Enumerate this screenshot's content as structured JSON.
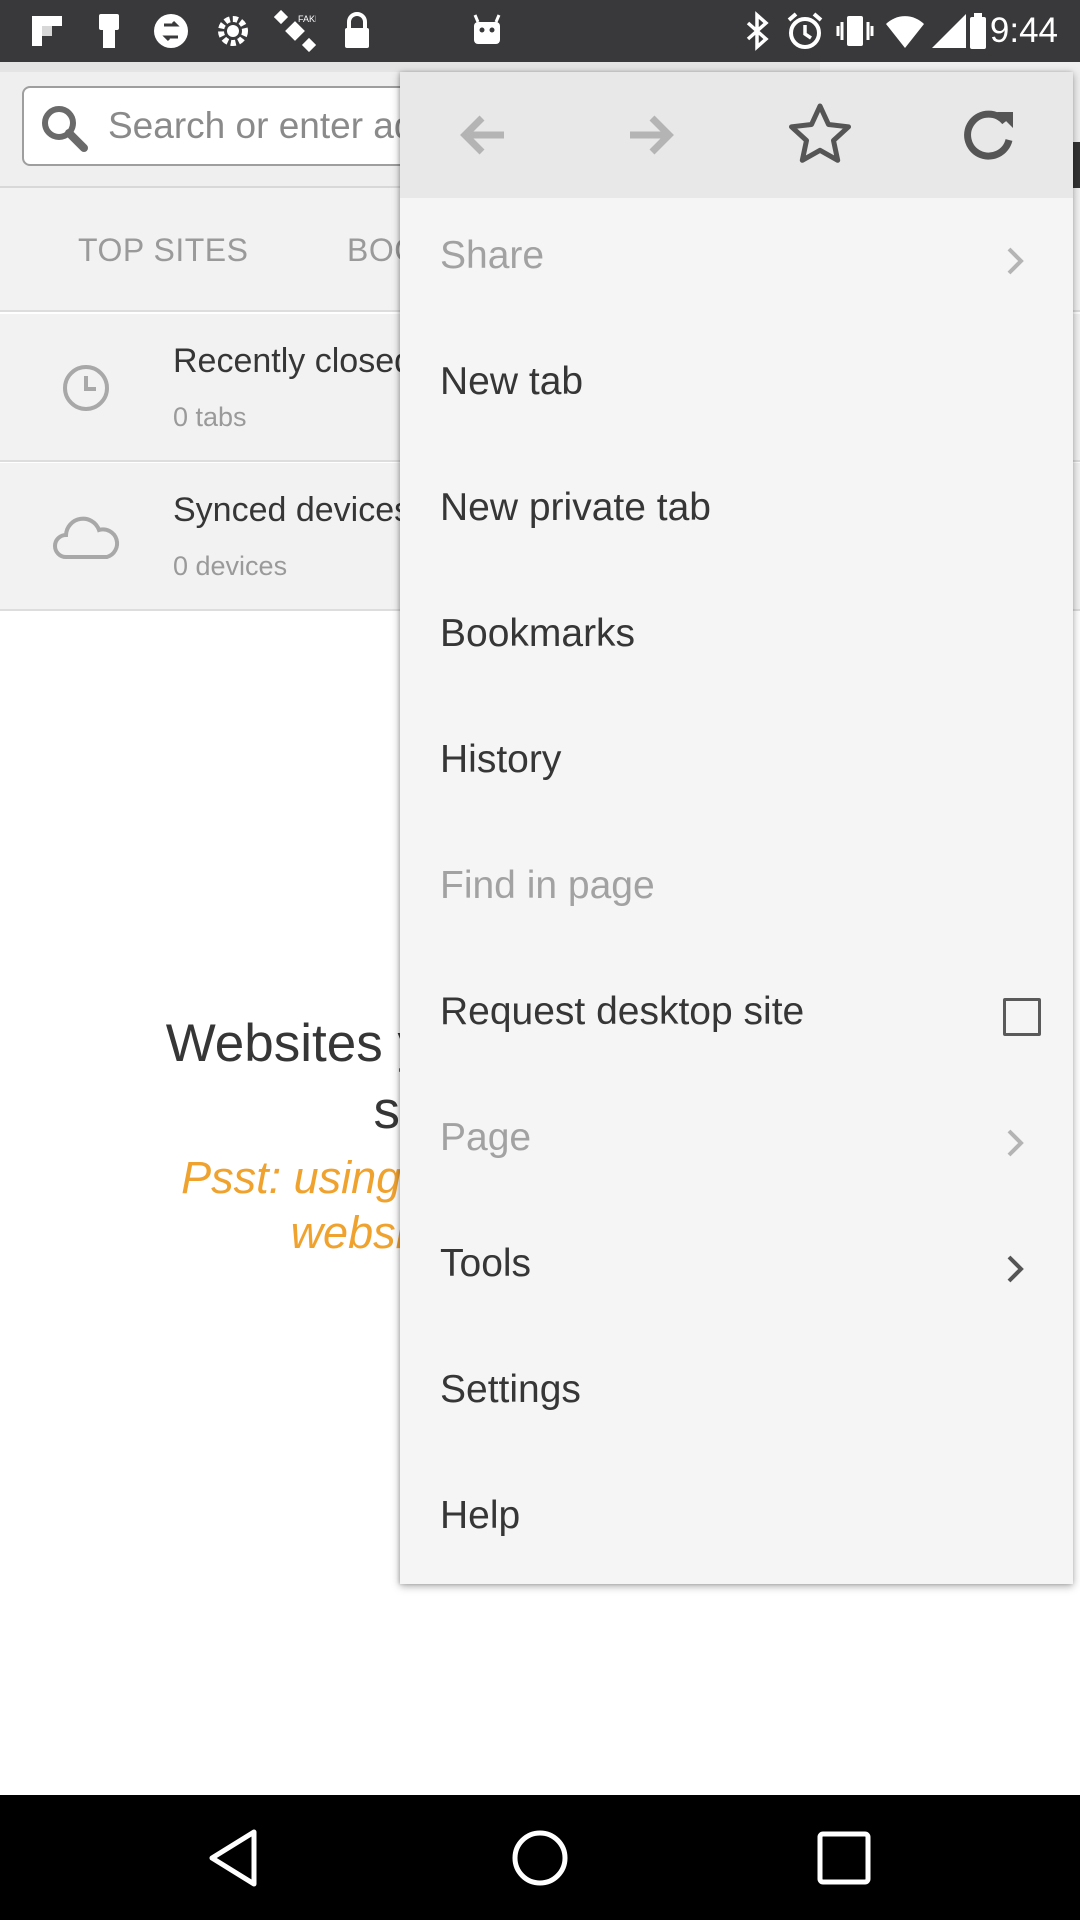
{
  "status_bar": {
    "time": "9:44",
    "icons": [
      "flipboard-icon",
      "usb-icon",
      "sync-circle-icon",
      "gear-icon",
      "satellite-icon",
      "lock-icon",
      "android-icon",
      "bluetooth-icon",
      "alarm-icon",
      "vibrate-icon",
      "wifi-icon",
      "cellular-icon",
      "battery-icon"
    ]
  },
  "toolbar": {
    "search_placeholder": "Search or enter address"
  },
  "home_panel": {
    "tabs": [
      "TOP SITES",
      "BOOKMARKS"
    ],
    "rows": [
      {
        "icon": "clock-icon",
        "title": "Recently closed",
        "subtitle": "0 tabs"
      },
      {
        "icon": "cloud-icon",
        "title": "Synced devices",
        "subtitle": "0 devices"
      }
    ],
    "empty_message": "Websites you've visited recently show up here.",
    "psst_message": "Psst: using Private Browsing means websites won't be saved."
  },
  "menu": {
    "top_icons": [
      "back-arrow-icon",
      "forward-arrow-icon",
      "star-icon",
      "reload-icon"
    ],
    "items": [
      {
        "label": "Share",
        "enabled": false,
        "submenu": true
      },
      {
        "label": "New tab",
        "enabled": true
      },
      {
        "label": "New private tab",
        "enabled": true
      },
      {
        "label": "Bookmarks",
        "enabled": true
      },
      {
        "label": "History",
        "enabled": true
      },
      {
        "label": "Find in page",
        "enabled": false
      },
      {
        "label": "Request desktop site",
        "enabled": true,
        "checkbox": true,
        "checked": false
      },
      {
        "label": "Page",
        "enabled": false,
        "submenu": true
      },
      {
        "label": "Tools",
        "enabled": true,
        "submenu": true
      },
      {
        "label": "Settings",
        "enabled": true
      },
      {
        "label": "Help",
        "enabled": true
      }
    ]
  },
  "nav_bar": {
    "buttons": [
      "back-triangle-icon",
      "home-circle-icon",
      "recents-square-icon"
    ]
  },
  "colors": {
    "status_bar": "#39393c",
    "menu_bg": "#f5f5f5",
    "accent_orange": "#f0a22f",
    "nav_bar": "#000000"
  }
}
